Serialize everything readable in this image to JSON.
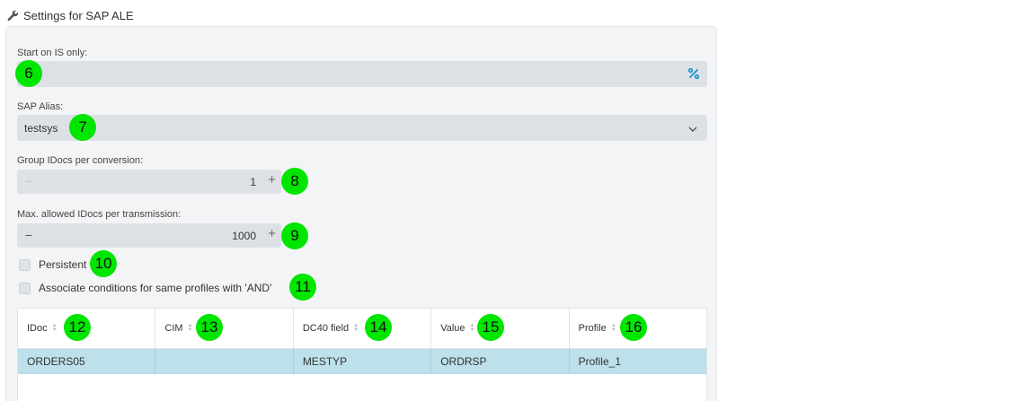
{
  "page": {
    "title": "Settings for SAP ALE"
  },
  "fields": {
    "start_on_is": {
      "label": "Start on IS only:",
      "value": "",
      "icon": "percent-icon"
    },
    "sap_alias": {
      "label": "SAP Alias:",
      "value": "testsys"
    },
    "group_idocs": {
      "label": "Group IDocs per conversion:",
      "value": "1",
      "minus": "−",
      "plus": "+"
    },
    "max_idocs": {
      "label": "Max. allowed IDocs per transmission:",
      "value": "1000",
      "minus": "−",
      "plus": "+"
    },
    "persistent": {
      "label": "Persistent",
      "checked": false
    },
    "associate_and": {
      "label": "Associate conditions for same profiles with 'AND'",
      "checked": false
    }
  },
  "table": {
    "columns": [
      "IDoc",
      "CIM",
      "DC40 field",
      "Value",
      "Profile"
    ],
    "rows": [
      [
        "ORDERS05",
        "",
        "MESTYP",
        "ORDRSP",
        "Profile_1"
      ]
    ]
  },
  "badges": [
    "6",
    "7",
    "8",
    "9",
    "10",
    "11",
    "12",
    "13",
    "14",
    "15",
    "16"
  ],
  "colors": {
    "badge": "#00e600",
    "selected_row": "#bde0ea",
    "accent": "#1a90c8"
  }
}
